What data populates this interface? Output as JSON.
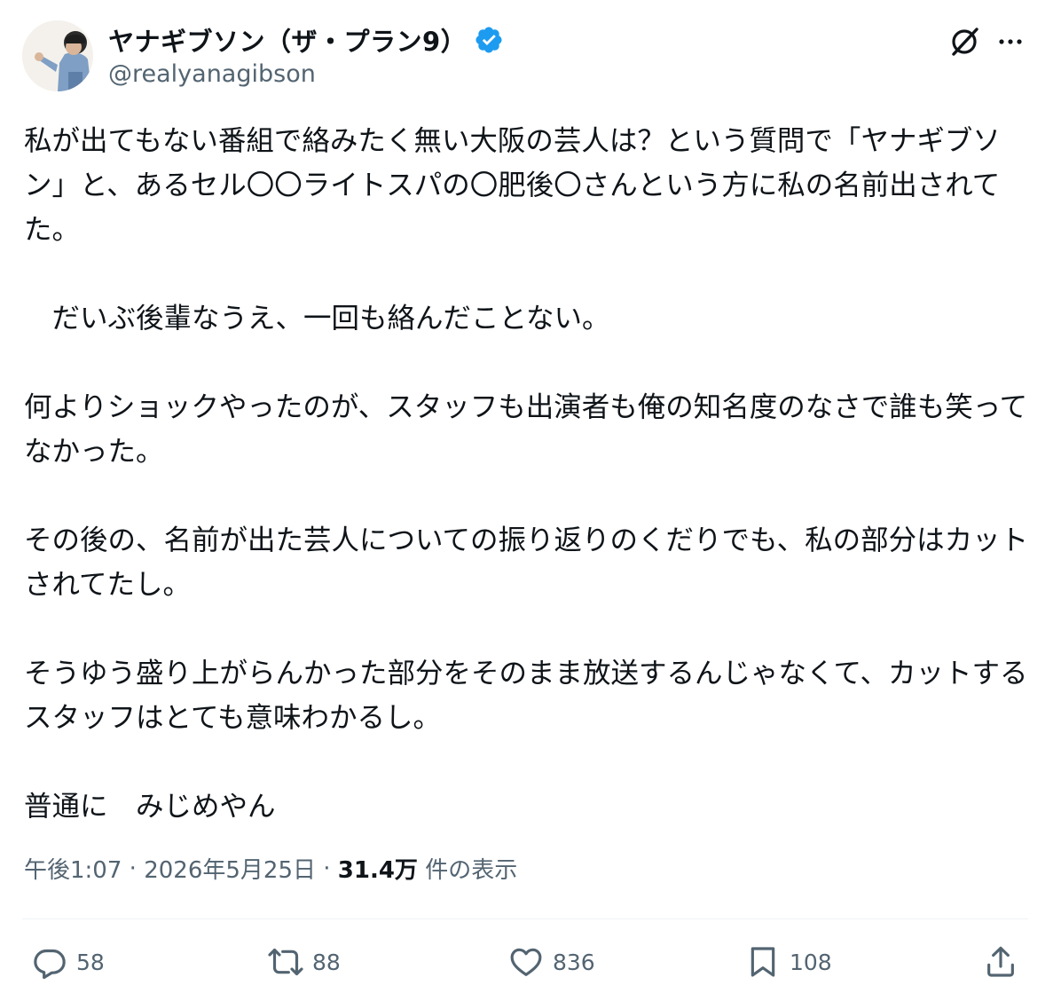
{
  "author": {
    "display_name": "ヤナギブソン（ザ・プラン9）",
    "handle": "@realyanagibson",
    "verified_icon": "verified-badge-icon",
    "badge_color": "#1d9bf0"
  },
  "header_actions": {
    "grok_icon": "grok-icon",
    "more_icon": "more-options-icon"
  },
  "post": {
    "paragraphs": [
      "私が出てもない番組で絡みたく無い大阪の芸人は？という質問で「ヤナギブソン」と、あるセル〇〇ライトスパの〇肥後〇さんという方に私の名前出されてた。",
      "　だいぶ後輩なうえ、一回も絡んだことない。",
      "何よりショックやったのが、スタッフも出演者も俺の知名度のなさで誰も笑ってなかった。",
      "その後の、名前が出た芸人についての振り返りのくだりでも、私の部分はカットされてたし。",
      "そうゆう盛り上がらんかった部分をそのまま放送するんじゃなくて、カットするスタッフはとても意味わかるし。",
      "普通に　みじめやん"
    ]
  },
  "meta": {
    "time": "午後1:07",
    "separator": " · ",
    "date": "2026年5月25日",
    "views_count": "31.4万",
    "views_label": " 件の表示"
  },
  "actions": {
    "reply": {
      "icon": "reply-icon",
      "count": "58"
    },
    "repost": {
      "icon": "repost-icon",
      "count": "88"
    },
    "like": {
      "icon": "heart-icon",
      "count": "836"
    },
    "bookmark": {
      "icon": "bookmark-icon",
      "count": "108"
    },
    "share": {
      "icon": "share-icon"
    }
  },
  "colors": {
    "text": "#0f1419",
    "secondary": "#536471",
    "divider": "#eff3f4"
  }
}
